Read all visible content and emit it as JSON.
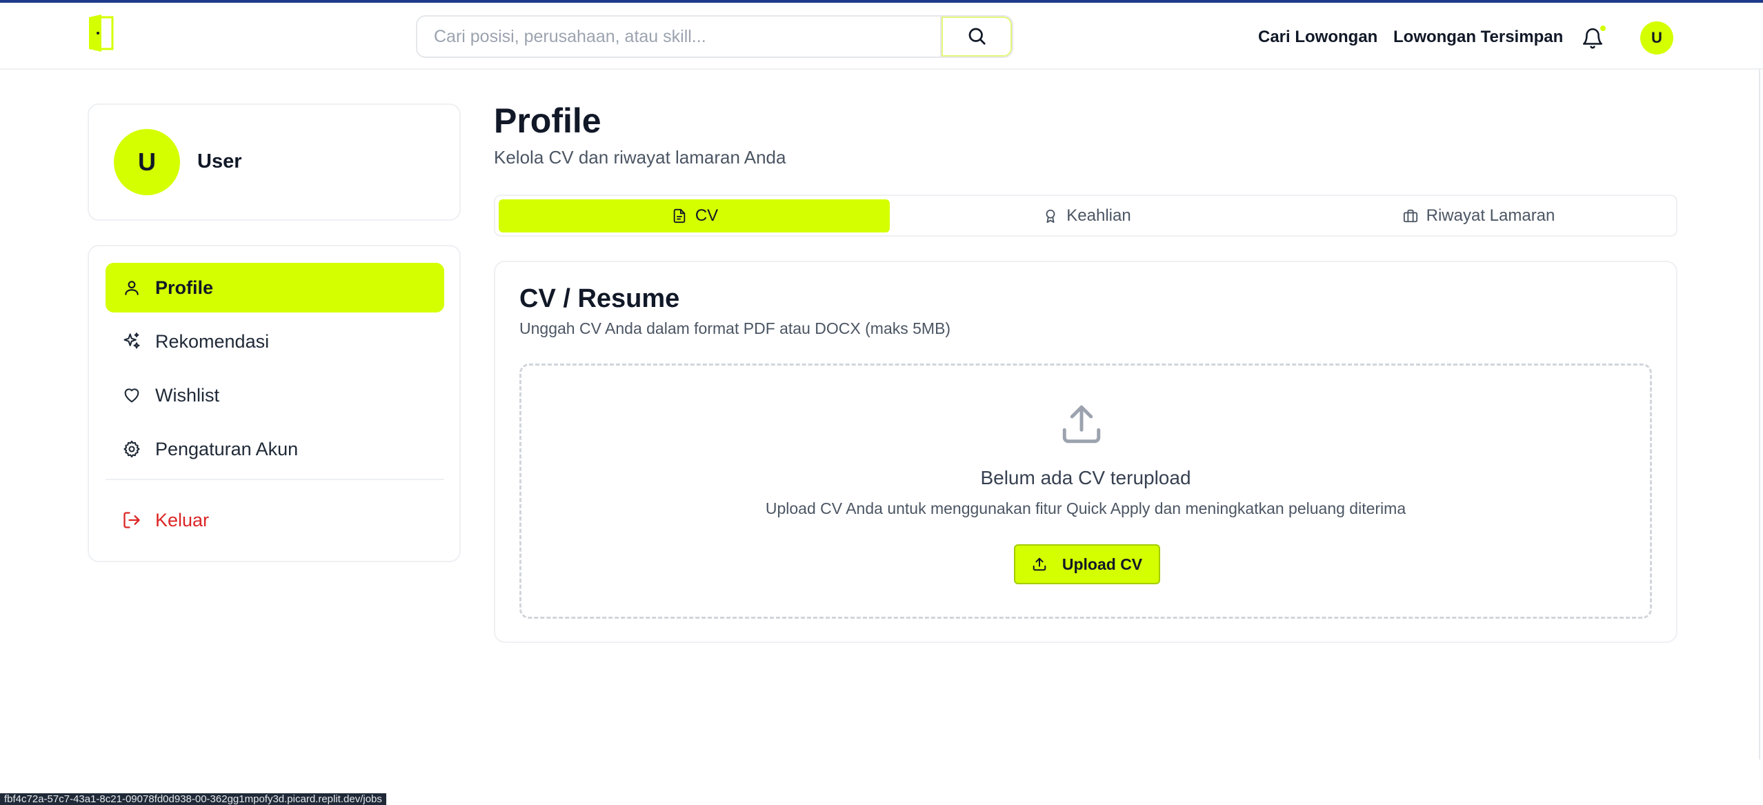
{
  "header": {
    "search_placeholder": "Cari posisi, perusahaan, atau skill...",
    "nav_links": [
      "Cari Lowongan",
      "Lowongan Tersimpan"
    ],
    "avatar_initial": "U",
    "accent_color": "#d4ff00"
  },
  "sidebar": {
    "user": {
      "initial": "U",
      "name": "User"
    },
    "items": [
      {
        "label": "Profile",
        "icon": "user-icon",
        "active": true
      },
      {
        "label": "Rekomendasi",
        "icon": "sparkles-icon",
        "active": false
      },
      {
        "label": "Wishlist",
        "icon": "heart-icon",
        "active": false
      },
      {
        "label": "Pengaturan Akun",
        "icon": "gear-icon",
        "active": false
      }
    ],
    "logout": {
      "label": "Keluar",
      "icon": "logout-icon",
      "color": "#dc2626"
    }
  },
  "main": {
    "title": "Profile",
    "subtitle": "Kelola CV dan riwayat lamaran Anda",
    "tabs": [
      {
        "label": "CV",
        "icon": "document-icon",
        "active": true
      },
      {
        "label": "Keahlian",
        "icon": "award-icon",
        "active": false
      },
      {
        "label": "Riwayat Lamaran",
        "icon": "briefcase-icon",
        "active": false
      }
    ],
    "cv_card": {
      "title": "CV / Resume",
      "description": "Unggah CV Anda dalam format PDF atau DOCX (maks 5MB)",
      "empty_title": "Belum ada CV terupload",
      "empty_description": "Upload CV Anda untuk menggunakan fitur Quick Apply dan meningkatkan peluang diterima",
      "upload_button": "Upload CV"
    }
  },
  "status_bar": {
    "url": "fbf4c72a-57c7-43a1-8c21-09078fd0d938-00-362gg1mpofy3d.picard.replit.dev/jobs"
  }
}
